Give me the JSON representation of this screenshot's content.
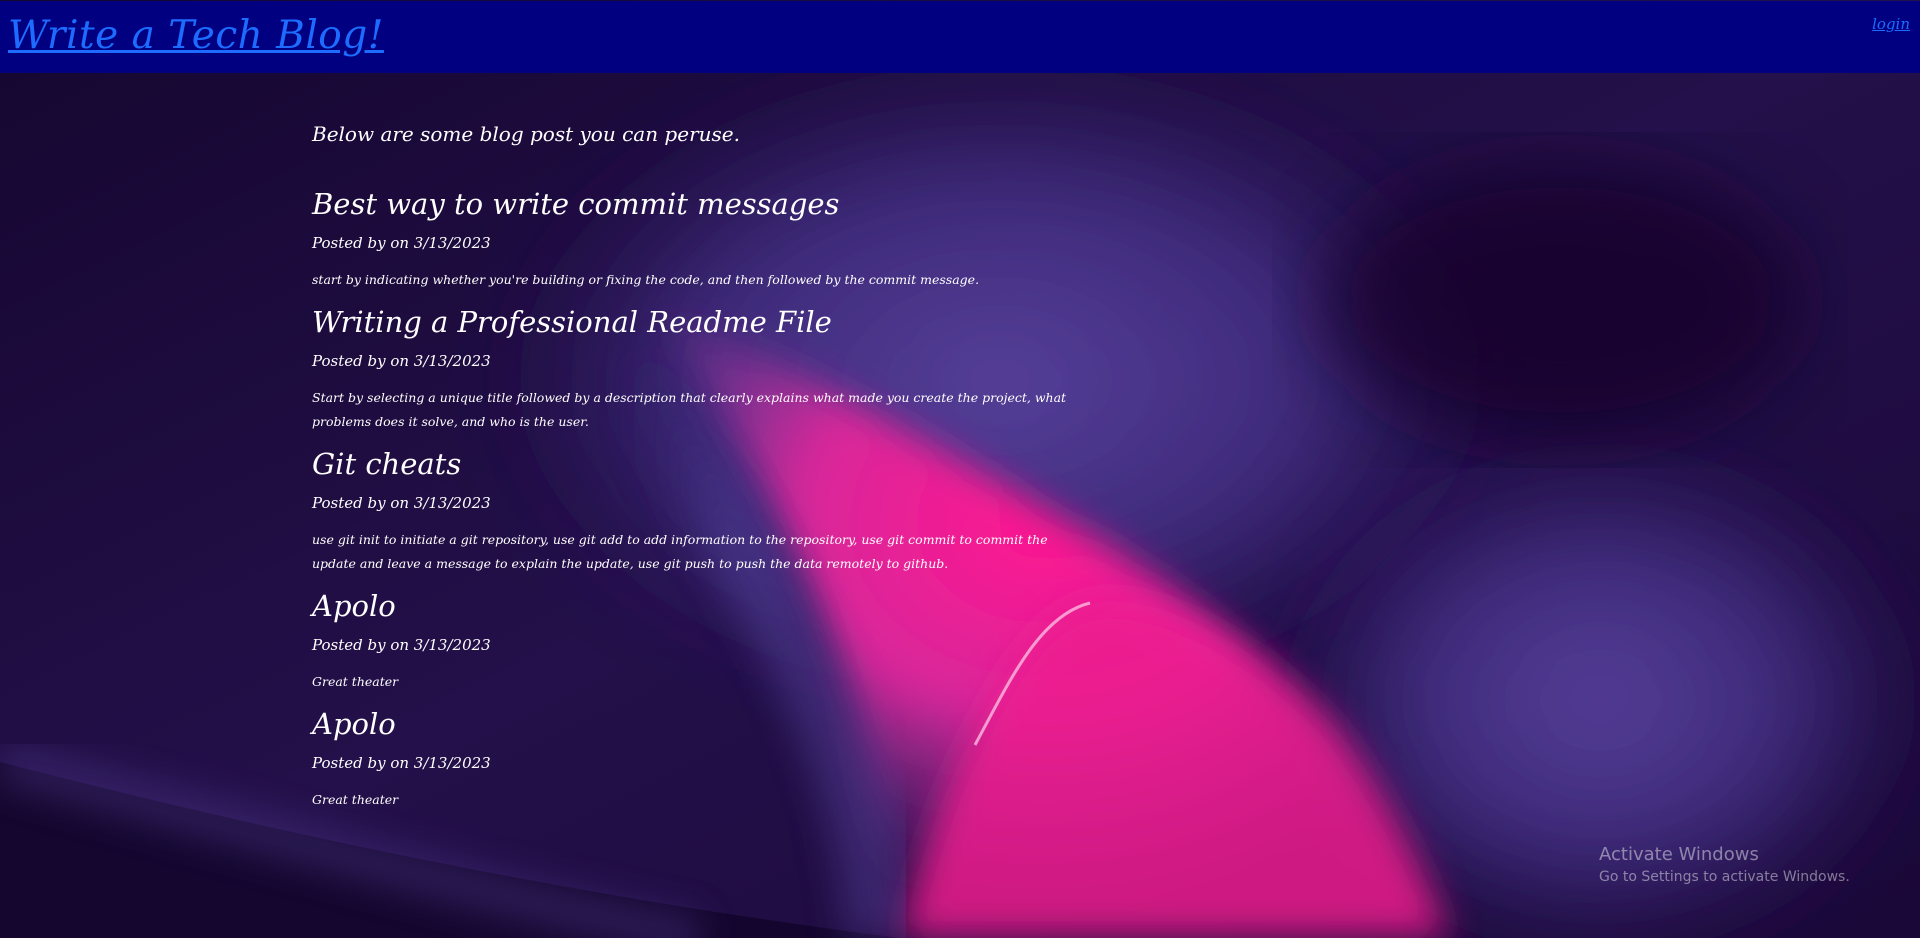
{
  "header": {
    "site_title": "Write a Tech Blog!",
    "login_label": "login",
    "bg_color": "#000080",
    "link_color": "#1d6cff"
  },
  "main": {
    "intro": "Below are some blog post you can peruse.",
    "posts": [
      {
        "title": "Best way to write commit messages",
        "meta": "Posted by on 3/13/2023",
        "body": "start by indicating whether you're building or fixing the code, and then followed by the commit message."
      },
      {
        "title": "Writing a Professional Readme File",
        "meta": "Posted by on 3/13/2023",
        "body": "Start by selecting a unique title followed by a description that clearly explains what made you create the project, what problems does it solve, and who is the user."
      },
      {
        "title": "Git cheats",
        "meta": "Posted by on 3/13/2023",
        "body": "use git init to initiate a git repository, use git add to add information to the repository, use git commit to commit the update and leave a message to explain the update, use git push to push the data remotely to github."
      },
      {
        "title": "Apolo",
        "meta": "Posted by on 3/13/2023",
        "body": "Great theater"
      },
      {
        "title": "Apolo",
        "meta": "Posted by on 3/13/2023",
        "body": "Great theater"
      }
    ]
  },
  "watermark": {
    "title": "Activate Windows",
    "subtitle": "Go to Settings to activate Windows."
  },
  "colors": {
    "background_dark": "#1a0838",
    "background_violet": "#4f3a8f",
    "accent_pink": "#ff1a8c"
  }
}
